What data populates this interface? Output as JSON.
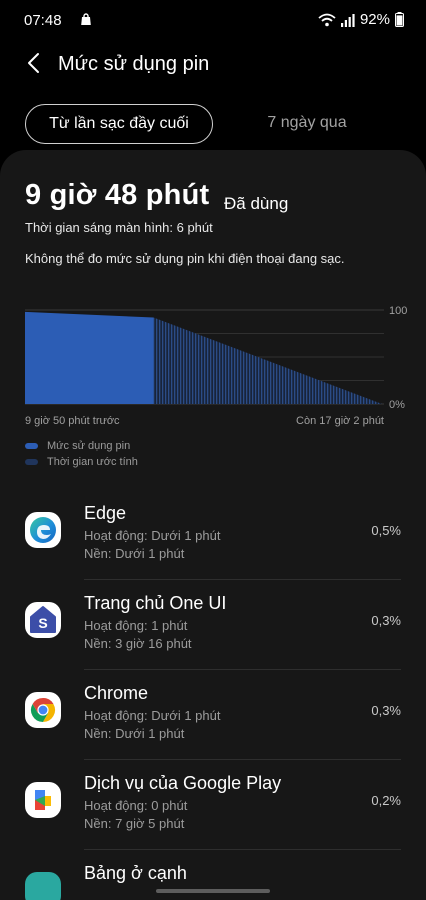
{
  "status_bar": {
    "time": "07:48",
    "battery_percent": "92%",
    "battery_level": 0.92,
    "icons": [
      "shopping-bag-icon",
      "wifi-icon",
      "signal-icon",
      "battery-icon"
    ]
  },
  "header": {
    "title": "Mức sử dụng pin",
    "back_icon": "chevron-left-icon"
  },
  "tabs": [
    {
      "label": "Từ lần sạc đầy cuối",
      "selected": true
    },
    {
      "label": "7 ngày qua",
      "selected": false
    }
  ],
  "summary": {
    "usage_time": "9 giờ 48 phút",
    "usage_suffix": "Đã dùng",
    "screen_on": "Thời gian sáng màn hình: 6 phút",
    "charging_note": "Không thể đo mức sử dụng pin khi điện thoại đang sạc."
  },
  "chart_data": {
    "type": "area",
    "ytick_labels": [
      "100",
      "0%"
    ],
    "ylim": [
      0,
      100
    ],
    "xlabel_start": "9 giờ 50 phút trước",
    "xlabel_end": "Còn 17 giờ 2 phút",
    "series": [
      {
        "name": "Mức sử dụng pin",
        "x": [
          0,
          36
        ],
        "values": [
          98,
          92
        ]
      },
      {
        "name": "Thời gian ước tính",
        "x": [
          36,
          100
        ],
        "values": [
          92,
          0
        ]
      }
    ],
    "colors": {
      "usage": "#2c5db5",
      "estimate": "#1e3a6e",
      "grid": "#3a3a3a"
    },
    "grid": true
  },
  "legend": [
    {
      "label": "Mức sử dụng pin",
      "color": "#2c5db5"
    },
    {
      "label": "Thời gian ước tính",
      "color": "#20355c"
    }
  ],
  "apps": [
    {
      "name": "Edge",
      "active": "Hoạt động: Dưới 1 phút",
      "background": "Nền: Dưới 1 phút",
      "percent": "0,5%",
      "icon": "edge-icon"
    },
    {
      "name": "Trang chủ One UI",
      "active": "Hoạt động: 1 phút",
      "background": "Nền: 3 giờ 16 phút",
      "percent": "0,3%",
      "icon": "one-ui-home-icon"
    },
    {
      "name": "Chrome",
      "active": "Hoạt động: Dưới 1 phút",
      "background": "Nền: Dưới 1 phút",
      "percent": "0,3%",
      "icon": "chrome-icon"
    },
    {
      "name": "Dịch vụ của Google Play",
      "active": "Hoạt động: 0 phút",
      "background": "Nền: 7 giờ 5 phút",
      "percent": "0,2%",
      "icon": "google-play-services-icon"
    },
    {
      "name": "Bảng ở cạnh",
      "active": "",
      "background": "",
      "percent": "",
      "icon": "edge-panel-icon"
    }
  ]
}
